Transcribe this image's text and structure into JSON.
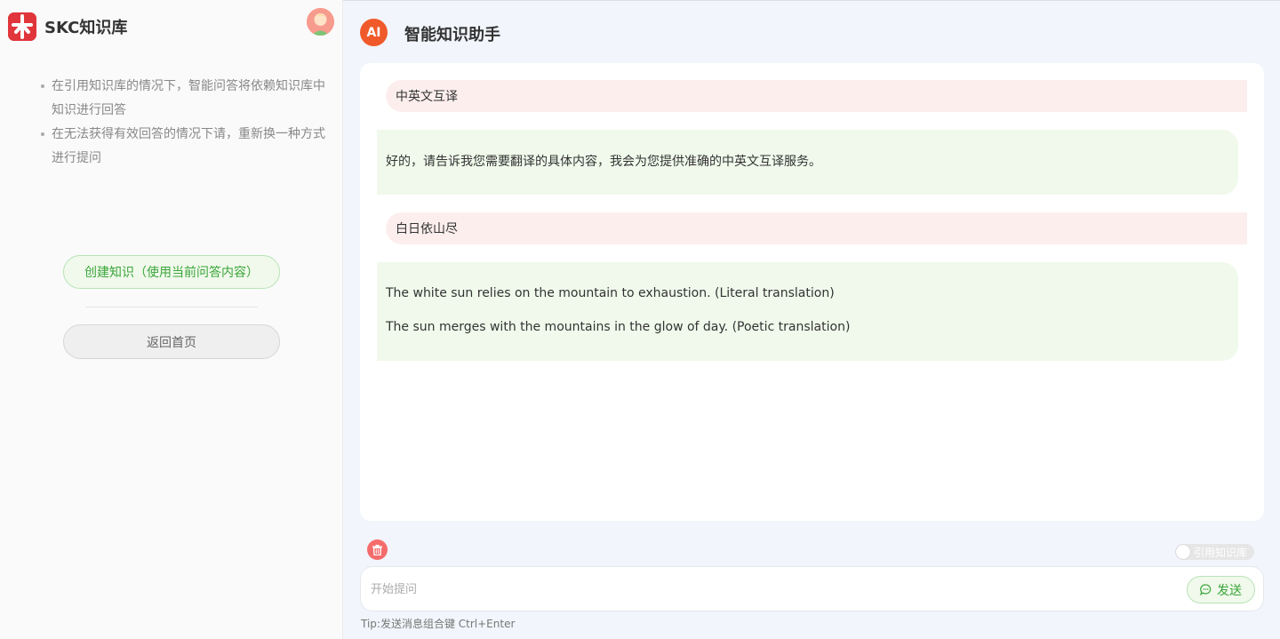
{
  "sidebar": {
    "brand_name": "SKC知识库",
    "tips": [
      "在引用知识库的情况下，智能问答将依赖知识库中知识进行回答",
      "在无法获得有效回答的情况下请，重新换一种方式进行提问"
    ],
    "create_button_label": "创建知识（使用当前问答内容）",
    "home_button_label": "返回首页"
  },
  "header": {
    "ai_badge": "AI",
    "title": "智能知识助手"
  },
  "messages": [
    {
      "role": "user",
      "text": "中英文互译"
    },
    {
      "role": "assistant",
      "lines": [
        "好的，请告诉我您需要翻译的具体内容，我会为您提供准确的中英文互译服务。"
      ]
    },
    {
      "role": "user",
      "text": "白日依山尽"
    },
    {
      "role": "assistant",
      "lines": [
        "The white sun relies on the mountain to exhaustion. (Literal translation)",
        "The sun merges with the mountains in the glow of day. (Poetic translation)"
      ]
    }
  ],
  "composer": {
    "toggle_label": "引用知识库",
    "toggle_on": false,
    "placeholder": "开始提问",
    "send_label": "发送",
    "tip": "Tip:发送消息组合键  Ctrl+Enter"
  },
  "colors": {
    "brand": "#e0353a",
    "ai_badge": "#f05a2a",
    "user_bubble": "#fdeeee",
    "assistant_bubble": "#f0f9eb",
    "accent_green": "#3aa53a",
    "delete": "#f56c6c"
  },
  "icons": {
    "logo": "brand-logo-icon",
    "avatar": "user-avatar",
    "delete": "trash-icon",
    "send": "chat-bubble-icon"
  }
}
